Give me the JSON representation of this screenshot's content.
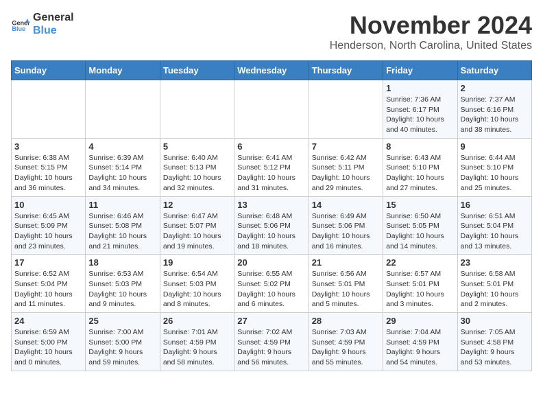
{
  "header": {
    "logo_line1": "General",
    "logo_line2": "Blue",
    "month": "November 2024",
    "location": "Henderson, North Carolina, United States"
  },
  "weekdays": [
    "Sunday",
    "Monday",
    "Tuesday",
    "Wednesday",
    "Thursday",
    "Friday",
    "Saturday"
  ],
  "weeks": [
    [
      {
        "day": "",
        "detail": ""
      },
      {
        "day": "",
        "detail": ""
      },
      {
        "day": "",
        "detail": ""
      },
      {
        "day": "",
        "detail": ""
      },
      {
        "day": "",
        "detail": ""
      },
      {
        "day": "1",
        "detail": "Sunrise: 7:36 AM\nSunset: 6:17 PM\nDaylight: 10 hours\nand 40 minutes."
      },
      {
        "day": "2",
        "detail": "Sunrise: 7:37 AM\nSunset: 6:16 PM\nDaylight: 10 hours\nand 38 minutes."
      }
    ],
    [
      {
        "day": "3",
        "detail": "Sunrise: 6:38 AM\nSunset: 5:15 PM\nDaylight: 10 hours\nand 36 minutes."
      },
      {
        "day": "4",
        "detail": "Sunrise: 6:39 AM\nSunset: 5:14 PM\nDaylight: 10 hours\nand 34 minutes."
      },
      {
        "day": "5",
        "detail": "Sunrise: 6:40 AM\nSunset: 5:13 PM\nDaylight: 10 hours\nand 32 minutes."
      },
      {
        "day": "6",
        "detail": "Sunrise: 6:41 AM\nSunset: 5:12 PM\nDaylight: 10 hours\nand 31 minutes."
      },
      {
        "day": "7",
        "detail": "Sunrise: 6:42 AM\nSunset: 5:11 PM\nDaylight: 10 hours\nand 29 minutes."
      },
      {
        "day": "8",
        "detail": "Sunrise: 6:43 AM\nSunset: 5:10 PM\nDaylight: 10 hours\nand 27 minutes."
      },
      {
        "day": "9",
        "detail": "Sunrise: 6:44 AM\nSunset: 5:10 PM\nDaylight: 10 hours\nand 25 minutes."
      }
    ],
    [
      {
        "day": "10",
        "detail": "Sunrise: 6:45 AM\nSunset: 5:09 PM\nDaylight: 10 hours\nand 23 minutes."
      },
      {
        "day": "11",
        "detail": "Sunrise: 6:46 AM\nSunset: 5:08 PM\nDaylight: 10 hours\nand 21 minutes."
      },
      {
        "day": "12",
        "detail": "Sunrise: 6:47 AM\nSunset: 5:07 PM\nDaylight: 10 hours\nand 19 minutes."
      },
      {
        "day": "13",
        "detail": "Sunrise: 6:48 AM\nSunset: 5:06 PM\nDaylight: 10 hours\nand 18 minutes."
      },
      {
        "day": "14",
        "detail": "Sunrise: 6:49 AM\nSunset: 5:06 PM\nDaylight: 10 hours\nand 16 minutes."
      },
      {
        "day": "15",
        "detail": "Sunrise: 6:50 AM\nSunset: 5:05 PM\nDaylight: 10 hours\nand 14 minutes."
      },
      {
        "day": "16",
        "detail": "Sunrise: 6:51 AM\nSunset: 5:04 PM\nDaylight: 10 hours\nand 13 minutes."
      }
    ],
    [
      {
        "day": "17",
        "detail": "Sunrise: 6:52 AM\nSunset: 5:04 PM\nDaylight: 10 hours\nand 11 minutes."
      },
      {
        "day": "18",
        "detail": "Sunrise: 6:53 AM\nSunset: 5:03 PM\nDaylight: 10 hours\nand 9 minutes."
      },
      {
        "day": "19",
        "detail": "Sunrise: 6:54 AM\nSunset: 5:03 PM\nDaylight: 10 hours\nand 8 minutes."
      },
      {
        "day": "20",
        "detail": "Sunrise: 6:55 AM\nSunset: 5:02 PM\nDaylight: 10 hours\nand 6 minutes."
      },
      {
        "day": "21",
        "detail": "Sunrise: 6:56 AM\nSunset: 5:01 PM\nDaylight: 10 hours\nand 5 minutes."
      },
      {
        "day": "22",
        "detail": "Sunrise: 6:57 AM\nSunset: 5:01 PM\nDaylight: 10 hours\nand 3 minutes."
      },
      {
        "day": "23",
        "detail": "Sunrise: 6:58 AM\nSunset: 5:01 PM\nDaylight: 10 hours\nand 2 minutes."
      }
    ],
    [
      {
        "day": "24",
        "detail": "Sunrise: 6:59 AM\nSunset: 5:00 PM\nDaylight: 10 hours\nand 0 minutes."
      },
      {
        "day": "25",
        "detail": "Sunrise: 7:00 AM\nSunset: 5:00 PM\nDaylight: 9 hours\nand 59 minutes."
      },
      {
        "day": "26",
        "detail": "Sunrise: 7:01 AM\nSunset: 4:59 PM\nDaylight: 9 hours\nand 58 minutes."
      },
      {
        "day": "27",
        "detail": "Sunrise: 7:02 AM\nSunset: 4:59 PM\nDaylight: 9 hours\nand 56 minutes."
      },
      {
        "day": "28",
        "detail": "Sunrise: 7:03 AM\nSunset: 4:59 PM\nDaylight: 9 hours\nand 55 minutes."
      },
      {
        "day": "29",
        "detail": "Sunrise: 7:04 AM\nSunset: 4:59 PM\nDaylight: 9 hours\nand 54 minutes."
      },
      {
        "day": "30",
        "detail": "Sunrise: 7:05 AM\nSunset: 4:58 PM\nDaylight: 9 hours\nand 53 minutes."
      }
    ]
  ]
}
